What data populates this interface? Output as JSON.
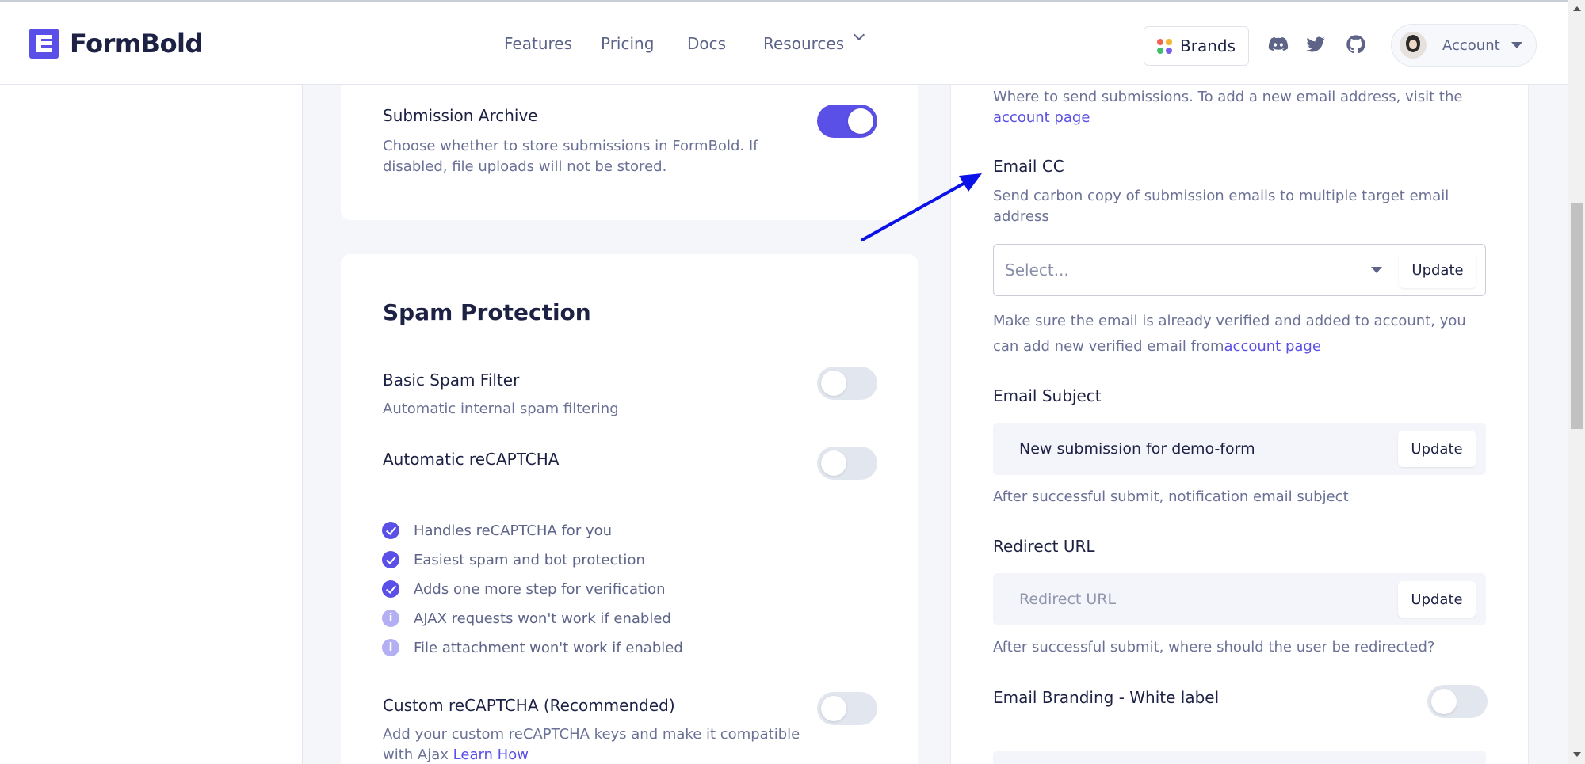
{
  "brand": {
    "name": "FormBold"
  },
  "nav": {
    "items": [
      "Features",
      "Pricing",
      "Docs",
      "Resources"
    ],
    "brands_label": "Brands",
    "account_label": "Account"
  },
  "submission_archive": {
    "title": "Submission Archive",
    "desc": "Choose whether to store submissions in FormBold. If disabled, file uploads will not be stored.",
    "enabled": true
  },
  "spam": {
    "title": "Spam Protection",
    "basic_title": "Basic Spam Filter",
    "basic_desc": "Automatic internal spam filtering",
    "basic_enabled": false,
    "auto_title": "Automatic reCAPTCHA",
    "auto_enabled": false,
    "features": [
      {
        "text": "Handles reCAPTCHA for you",
        "icon": "check-icon"
      },
      {
        "text": "Easiest spam and bot protection",
        "icon": "check-icon"
      },
      {
        "text": "Adds one more step for verification",
        "icon": "check-icon"
      },
      {
        "text": "AJAX requests won't work if enabled",
        "icon": "info-icon"
      },
      {
        "text": "File attachment won't work if enabled",
        "icon": "info-icon"
      }
    ],
    "custom_title": "Custom reCAPTCHA (Recommended)",
    "custom_desc": "Add your custom reCAPTCHA keys and make it compatible with Ajax",
    "custom_link": "Learn How",
    "custom_enabled": false
  },
  "email_to": {
    "desc": "Where to send submissions. To add a new email address, visit the",
    "link": "account page"
  },
  "email_cc": {
    "title": "Email CC",
    "desc": "Send carbon copy of submission emails to multiple target email address",
    "placeholder": "Select...",
    "update_label": "Update",
    "note": "Make sure the email is already verified and added to account, you can add new verified email from",
    "note_link": "account page"
  },
  "email_subject": {
    "title": "Email Subject",
    "value": "New submission for demo-form",
    "update_label": "Update",
    "help": "After successful submit, notification email subject"
  },
  "redirect": {
    "title": "Redirect URL",
    "placeholder": "Redirect URL",
    "update_label": "Update",
    "help": "After successful submit, where should the user be redirected?"
  },
  "branding": {
    "title": "Email Branding - White label",
    "enabled": false
  },
  "colors": {
    "accent": "#5a4fe6",
    "annotation_arrow": "#0a12e8"
  }
}
